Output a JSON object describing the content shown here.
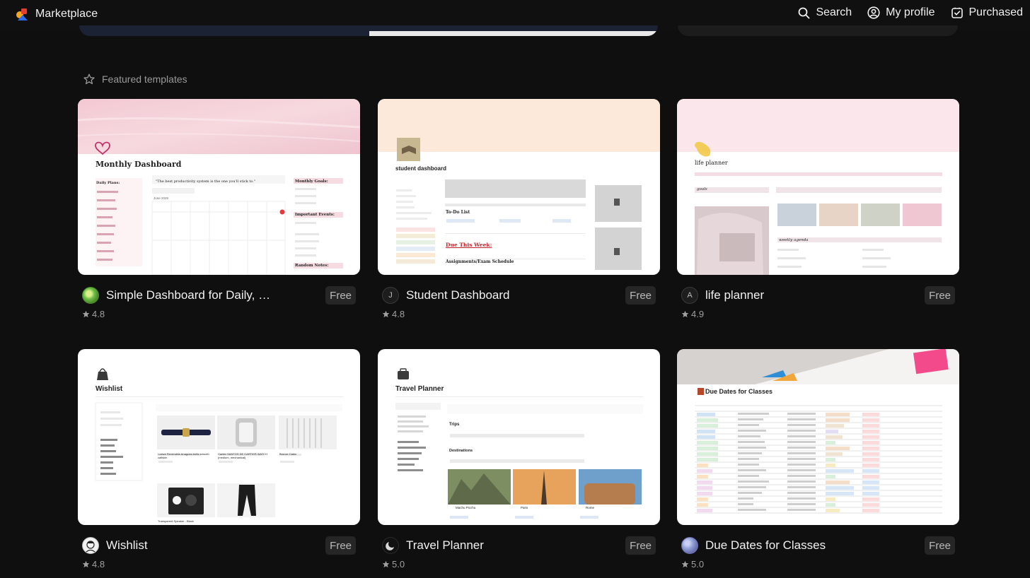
{
  "header": {
    "brand_title": "Marketplace",
    "nav": [
      {
        "label": "Search",
        "icon": "search-icon"
      },
      {
        "label": "My profile",
        "icon": "profile-icon"
      },
      {
        "label": "Purchased",
        "icon": "purchased-icon"
      }
    ]
  },
  "section": {
    "title": "Featured templates",
    "icon": "star-outline-icon"
  },
  "cards": [
    {
      "title": "Simple Dashboard for Daily, We...",
      "price": "Free",
      "rating": "4.8",
      "author_initial": "",
      "preview": {
        "heading": "Monthly Dashboard",
        "quote": "\"The best productivity system is the one you'll stick to.\"",
        "col_left": "Daily Plans:",
        "col_right1": "Monthly Goals:",
        "col_right2": "Important Events:",
        "col_right3": "Random Notes:",
        "cal_label": "June 2025"
      }
    },
    {
      "title": "Student Dashboard",
      "price": "Free",
      "rating": "4.8",
      "author_initial": "J",
      "preview": {
        "heading": "student dashboard",
        "todo": "To-Do List",
        "due": "Due This Week:",
        "exams": "Assignments/Exam Schedule"
      }
    },
    {
      "title": "life planner",
      "price": "Free",
      "rating": "4.9",
      "author_initial": "A",
      "preview": {
        "heading": "life planner",
        "goals": "goals",
        "agenda": "weekly agenda"
      }
    },
    {
      "title": "Wishlist",
      "price": "Free",
      "rating": "4.8",
      "author_initial": "",
      "preview": {
        "heading": "Wishlist",
        "item1": "Loewe Reversible Anagram belts smooth calfskin",
        "item2": "Cartier SANTOS DE CARTIER WATCH (medium, mechanical)",
        "item3": "Bronze Cabin",
        "item4": "Transparent Speaker - Black"
      }
    },
    {
      "title": "Travel Planner",
      "price": "Free",
      "rating": "5.0",
      "author_initial": "",
      "preview": {
        "heading": "Travel Planner",
        "trips": "Trips",
        "destinations": "Destinations",
        "dest1": "Machu Picchu",
        "dest2": "Paris",
        "dest3": "Rome"
      }
    },
    {
      "title": "Due Dates for Classes",
      "price": "Free",
      "rating": "5.0",
      "author_initial": "",
      "preview": {
        "heading": "Due Dates for Classes"
      }
    }
  ],
  "colors": {
    "background": "#0f0f0f",
    "badge_bg": "#262626",
    "text_muted": "#9f9f9f"
  }
}
